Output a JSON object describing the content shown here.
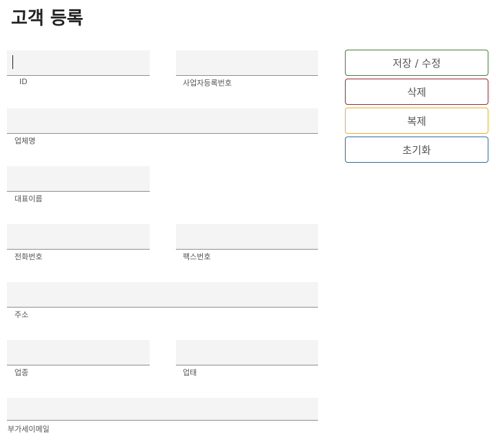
{
  "page": {
    "title": "고객 등록"
  },
  "form": {
    "id": {
      "label": "ID",
      "value": ""
    },
    "business_number": {
      "label": "사업자등록번호",
      "value": ""
    },
    "company_name": {
      "label": "업체명",
      "value": ""
    },
    "representative": {
      "label": "대표이름",
      "value": ""
    },
    "phone": {
      "label": "전화번호",
      "value": ""
    },
    "fax": {
      "label": "팩스번호",
      "value": ""
    },
    "address": {
      "label": "주소",
      "value": ""
    },
    "business_type": {
      "label": "업종",
      "value": ""
    },
    "business_category": {
      "label": "업태",
      "value": ""
    },
    "vat_email": {
      "label": "부가세이메일",
      "value": ""
    }
  },
  "actions": {
    "save_label": "저장 / 수정",
    "delete_label": "삭제",
    "copy_label": "복제",
    "reset_label": "초기화"
  },
  "colors": {
    "save_border": "#4a7a3a",
    "delete_border": "#a02430",
    "copy_border": "#e8b020",
    "reset_border": "#2a6aa0",
    "field_bg": "#f4f4f4",
    "field_underline": "#8d8d8d"
  }
}
